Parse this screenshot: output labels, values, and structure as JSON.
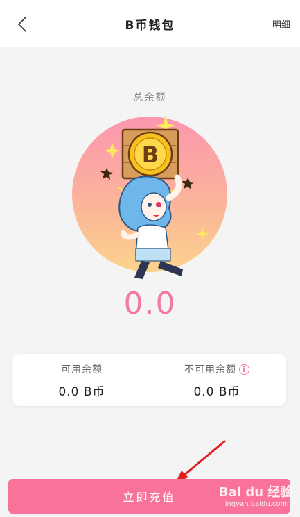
{
  "header": {
    "title": "B币钱包",
    "detail_label": "明细"
  },
  "wallet": {
    "total_label": "总余额",
    "total_value": "0.0",
    "available_label": "可用余额",
    "available_value": "0.0 B币",
    "unavailable_label": "不可用余额",
    "unavailable_value": "0.0 B币",
    "coin_letter": "B"
  },
  "actions": {
    "recharge_label": "立即充值"
  },
  "watermark": {
    "brand": "Bai du 经验",
    "url": "jingyan.baidu.com"
  },
  "colors": {
    "accent": "#f97299",
    "balance": "#f27a9f"
  }
}
